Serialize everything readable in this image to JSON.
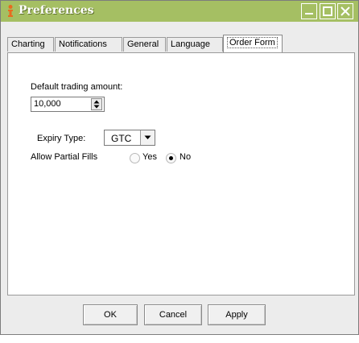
{
  "window": {
    "title": "Preferences",
    "icons": [
      "app-icon",
      "minimize-icon",
      "maximize-icon",
      "close-icon"
    ]
  },
  "tabs": [
    {
      "label": "Charting"
    },
    {
      "label": "Notifications"
    },
    {
      "label": "General"
    },
    {
      "label": "Language"
    },
    {
      "label": "Order Form"
    }
  ],
  "active_tab": "Order Form",
  "order_form": {
    "default_amount_label": "Default trading amount:",
    "default_amount_value": "10,000",
    "expiry_label": "Expiry Type:",
    "expiry_value": "GTC",
    "partial_fills_label": "Allow Partial Fills",
    "partial_yes": "Yes",
    "partial_no": "No",
    "partial_selected": "No"
  },
  "buttons": {
    "ok": "OK",
    "cancel": "Cancel",
    "apply": "Apply"
  },
  "colors": {
    "titlebar": "#a5bf63",
    "dialog_bg": "#ececec",
    "panel_bg": "#ffffff"
  }
}
